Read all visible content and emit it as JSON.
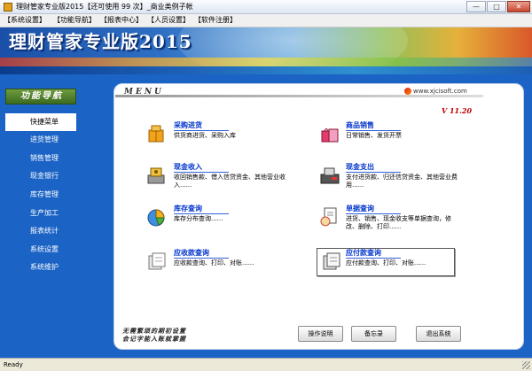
{
  "window": {
    "title": "理财管家专业版2015【还可使用 99 次】_商业类例子帐",
    "controls": {
      "minimize": "—",
      "maximize": "□",
      "close": "✕"
    }
  },
  "menubar": [
    "【系统设置】",
    "【功能导航】",
    "【报表中心】",
    "【人员设置】",
    "【软件注册】"
  ],
  "banner": {
    "title": "理财管家专业版2015"
  },
  "nav": {
    "header": "功能导航",
    "items": [
      "快捷菜单",
      "进货管理",
      "销售管理",
      "现金银行",
      "库存管理",
      "生产加工",
      "报表统计",
      "系统设置",
      "系统维护"
    ],
    "active_index": 0
  },
  "panel": {
    "menu_word": "MENU",
    "site": "www.xjcisoft.com",
    "version": "V 11.20",
    "functions": [
      {
        "title": "采购进货",
        "desc": "供货商进货、采购入库",
        "icon": "purchase-box-icon"
      },
      {
        "title": "商品销售",
        "desc": "日常销售、发货开票",
        "icon": "shopping-bag-icon"
      },
      {
        "title": "现金收入",
        "desc": "收回销售款、借入信贷资金、其他营业收入......",
        "icon": "cash-income-icon"
      },
      {
        "title": "现金支出",
        "desc": "支付进货款、归还信贷资金、其他营业费用......",
        "icon": "cash-expense-icon"
      },
      {
        "title": "库存查询",
        "desc": "库存分布查询......",
        "icon": "pie-chart-icon"
      },
      {
        "title": "单据查询",
        "desc": "进货、销售、现金收支等单据查询，修改、删除、打印......",
        "icon": "document-search-icon"
      },
      {
        "title": "应收款查询",
        "desc": "应收款查询、打印、对账......",
        "icon": "receivable-icon"
      },
      {
        "title": "应付款查询",
        "desc": "应付款查询、打印、对账......",
        "icon": "payable-icon"
      }
    ],
    "slogan": [
      "无需繁琐的期初设置",
      "会记字能入账就掌握"
    ],
    "buttons": [
      "操作说明",
      "备忘录",
      "退出系统"
    ]
  },
  "status": "Ready",
  "colors": {
    "frame_blue": "#1b63c5",
    "link_blue": "#0033cc",
    "version_red": "#c00000",
    "nav_header_green": "#4f7f2a"
  }
}
